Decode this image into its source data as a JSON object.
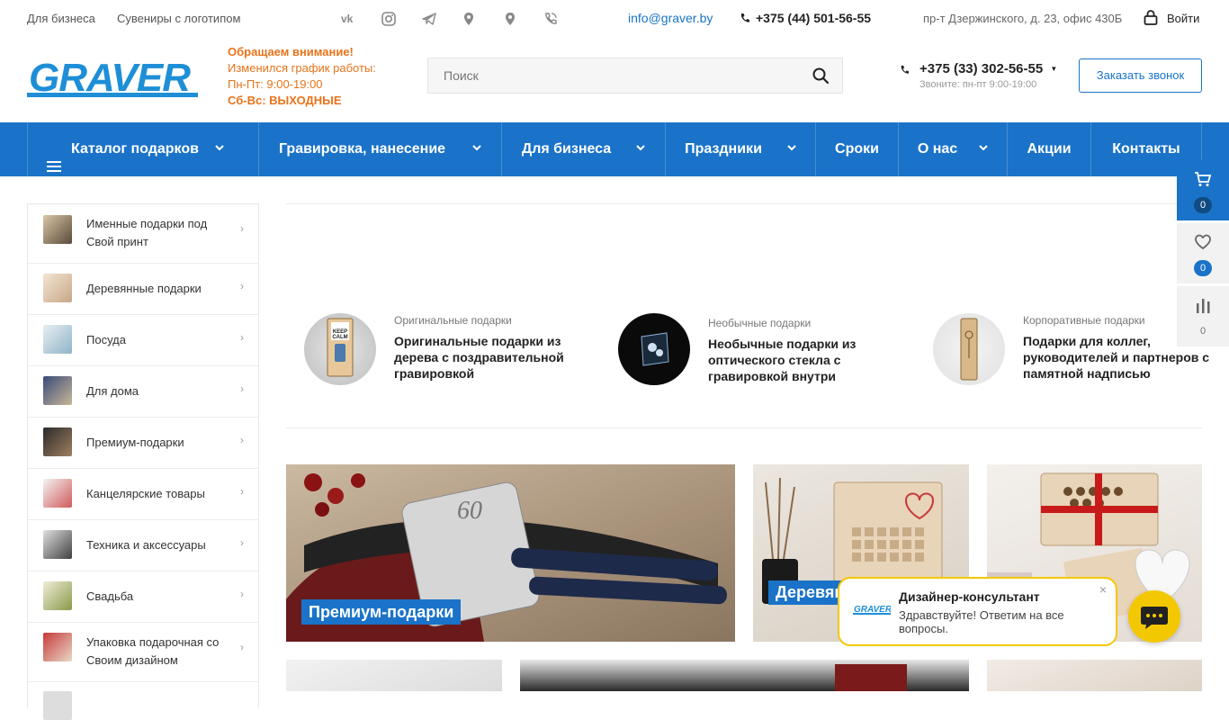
{
  "topbar": {
    "link_business": "Для бизнеса",
    "link_souvenirs": "Сувениры с логотипом",
    "email": "info@graver.by",
    "phone": "+375 (44) 501-56-55",
    "address": "пр-т Дзержинского, д. 23, офис 430Б",
    "login": "Войти"
  },
  "logo": {
    "text": "GRAVER"
  },
  "notice": {
    "line1": "Обращаем внимание!",
    "line2": "Изменился график работы:",
    "line3": "Пн-Пт: 9:00-19:00",
    "line4": "Сб-Вс: ВЫХОДНЫЕ"
  },
  "search": {
    "placeholder": "Поиск"
  },
  "header_phone": {
    "number": "+375 (33) 302-56-55",
    "hours": "Звоните: пн-пт 9:00-19:00"
  },
  "callback_button": "Заказать звонок",
  "nav": {
    "catalog": "Каталог подарков",
    "engraving": "Гравировка, нанесение",
    "business": "Для бизнеса",
    "holidays": "Праздники",
    "terms": "Сроки",
    "about": "О нас",
    "promo": "Акции",
    "contacts": "Контакты"
  },
  "sidebar": {
    "items": [
      {
        "label": "Именные подарки под Свой принт"
      },
      {
        "label": "Деревянные подарки"
      },
      {
        "label": "Посуда"
      },
      {
        "label": "Для дома"
      },
      {
        "label": "Премиум-подарки"
      },
      {
        "label": "Канцелярские товары"
      },
      {
        "label": "Техника и аксессуары"
      },
      {
        "label": "Свадьба"
      },
      {
        "label": "Упаковка подарочная со Своим дизайном"
      }
    ]
  },
  "features": [
    {
      "category": "Оригинальные подарки",
      "title": "Оригинальные подарки из дерева с поздравительной гравировкой"
    },
    {
      "category": "Необычные подарки",
      "title": "Необычные подарки из оптического стекла с гравировкой внутри"
    },
    {
      "category": "Корпоративные подарки",
      "title": "Подарки для коллег, руководителей и партнеров с памятной надписью"
    }
  ],
  "banners": {
    "premium": "Премиум-подарки",
    "wooden": "Деревянные подарки"
  },
  "floating": {
    "cart_count": "0",
    "wishlist_count": "0",
    "compare_count": "0"
  },
  "chat": {
    "title": "Дизайнер-консультант",
    "message": "Здравствуйте! Ответим на все вопросы.",
    "close": "×"
  }
}
